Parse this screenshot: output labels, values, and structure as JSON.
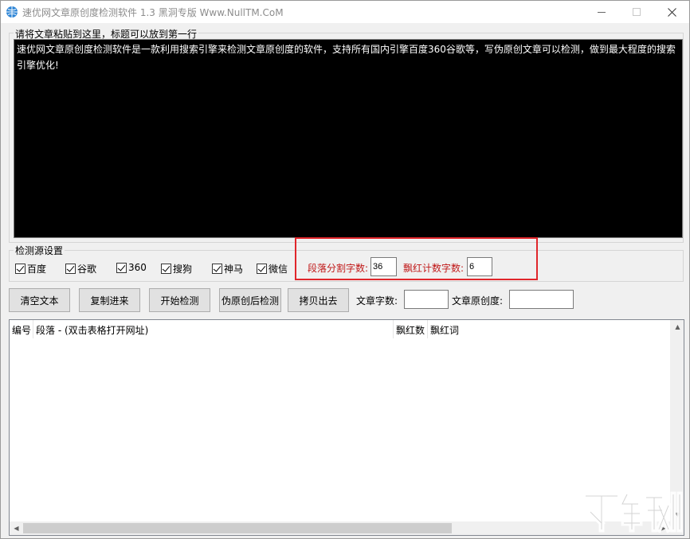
{
  "window": {
    "title": "速优网文章原创度检测软件 1.3    黑洞专版 Www.NullTM.CoM"
  },
  "article": {
    "group_label": "请将文章粘贴到这里，标题可以放到第一行",
    "text": "速优网文章原创度检测软件是一款利用搜索引擎来检测文章原创度的软件，支持所有国内引擎百度360谷歌等，写伪原创文章可以检测，做到最大程度的搜索引擎优化!"
  },
  "sources": {
    "group_label": "检测源设置",
    "items": [
      {
        "label": "百度",
        "checked": true
      },
      {
        "label": "谷歌",
        "checked": true
      },
      {
        "label": "360",
        "checked": true
      },
      {
        "label": "搜狗",
        "checked": true
      },
      {
        "label": "神马",
        "checked": true
      },
      {
        "label": "微信",
        "checked": true
      }
    ],
    "split_label": "段落分割字数:",
    "split_value": "36",
    "red_label": "飘红计数字数:",
    "red_value": "6"
  },
  "toolbar": {
    "clear": "清空文本",
    "paste": "复制进来",
    "start": "开始检测",
    "pseudo": "伪原创后检测",
    "copy_out": "拷贝出去",
    "word_count_label": "文章字数:",
    "word_count_value": "",
    "originality_label": "文章原创度:",
    "originality_value": ""
  },
  "grid": {
    "columns": [
      "编号",
      "段落 - (双击表格打开网址)",
      "飘红数",
      "飘红词"
    ]
  },
  "colors": {
    "highlight_red": "#e0262b",
    "label_red": "#c01818"
  }
}
